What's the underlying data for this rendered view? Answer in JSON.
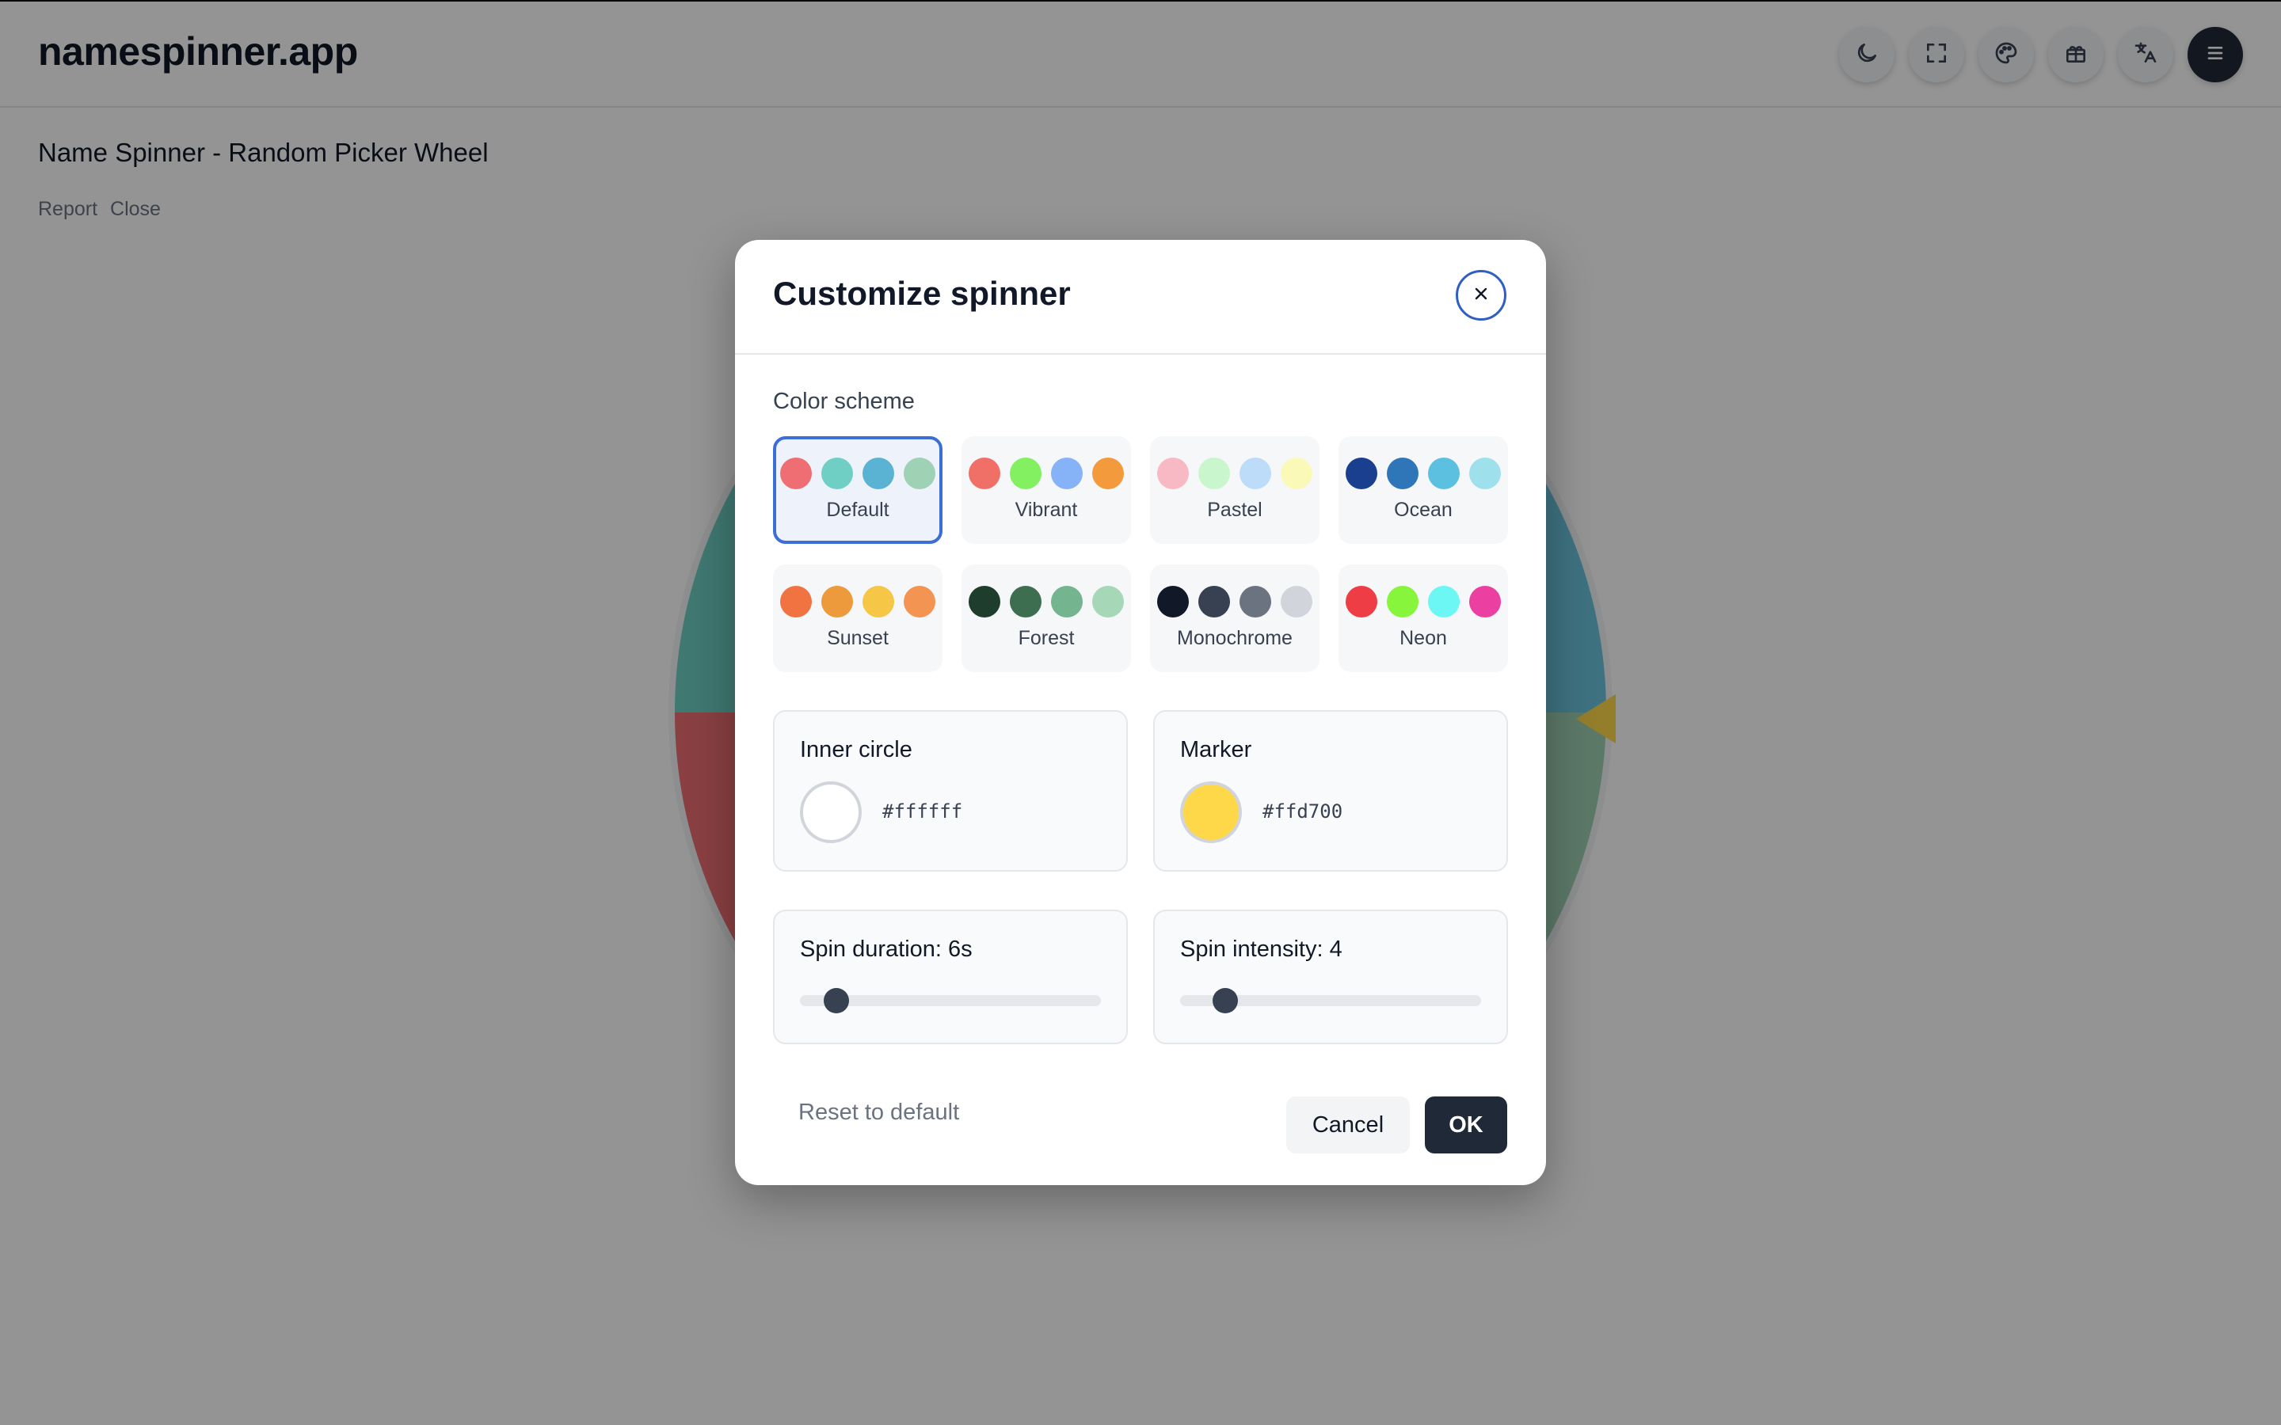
{
  "app": {
    "title": "namespinner.app"
  },
  "header_icons": [
    {
      "name": "moon-icon"
    },
    {
      "name": "fullscreen-icon"
    },
    {
      "name": "palette-icon"
    },
    {
      "name": "gift-icon"
    },
    {
      "name": "translate-icon"
    },
    {
      "name": "menu-icon"
    }
  ],
  "page": {
    "title": "Name Spinner - Random Picker Wheel",
    "links": [
      "Report",
      "Close"
    ]
  },
  "modal": {
    "title": "Customize spinner",
    "color_scheme_label": "Color scheme",
    "schemes": [
      {
        "name": "Default",
        "selected": true,
        "colors": [
          "#ee6e73",
          "#6fcfc4",
          "#5bb3d4",
          "#9fd1b4"
        ]
      },
      {
        "name": "Vibrant",
        "selected": false,
        "colors": [
          "#f07068",
          "#82f060",
          "#86b2f8",
          "#f39a3c"
        ]
      },
      {
        "name": "Pastel",
        "selected": false,
        "colors": [
          "#f8b8c4",
          "#c9f6cc",
          "#bcdcfa",
          "#fbf9b8"
        ]
      },
      {
        "name": "Ocean",
        "selected": false,
        "colors": [
          "#1b3f8f",
          "#2f76b8",
          "#5cc0e0",
          "#9ee0ec"
        ]
      },
      {
        "name": "Sunset",
        "selected": false,
        "colors": [
          "#f27342",
          "#ec9a3c",
          "#f6c646",
          "#f49453"
        ]
      },
      {
        "name": "Forest",
        "selected": false,
        "colors": [
          "#1f3d2c",
          "#3d6e50",
          "#74b48e",
          "#a6d7b6"
        ]
      },
      {
        "name": "Monochrome",
        "selected": false,
        "colors": [
          "#111827",
          "#374151",
          "#6b7280",
          "#d1d5db"
        ]
      },
      {
        "name": "Neon",
        "selected": false,
        "colors": [
          "#ef3d45",
          "#86f53c",
          "#6cf7f5",
          "#ec3fa2"
        ]
      }
    ],
    "inner_circle": {
      "label": "Inner circle",
      "value": "#ffffff",
      "color": "#ffffff"
    },
    "marker": {
      "label": "Marker",
      "value": "#ffd700",
      "color": "#ffd84a"
    },
    "spin_duration": {
      "label": "Spin duration: 6s",
      "value": 6,
      "fraction": 0.12
    },
    "spin_intensity": {
      "label": "Spin intensity: 4",
      "value": 4,
      "fraction": 0.15
    },
    "reset_label": "Reset to default",
    "cancel_label": "Cancel",
    "ok_label": "OK"
  }
}
